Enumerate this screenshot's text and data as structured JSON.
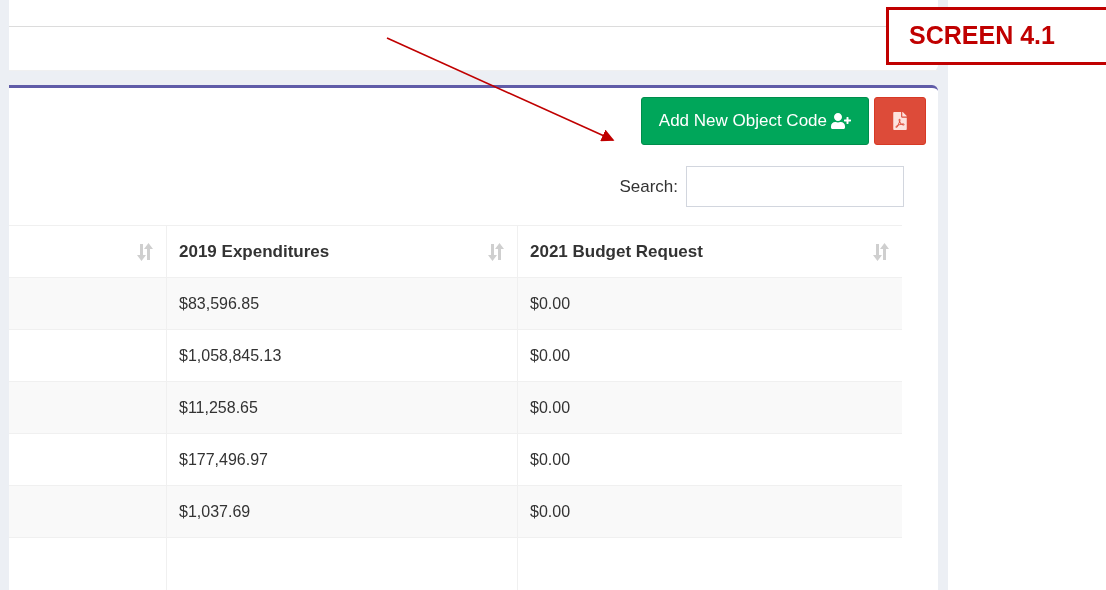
{
  "toolbar": {
    "add_button": {
      "label": "Add New Object Code"
    },
    "pdf_button": {
      "kind": "pdf"
    }
  },
  "search": {
    "label": "Search:"
  },
  "table": {
    "columns": [
      {
        "sortable": true
      },
      {
        "label": "2019 Expenditures",
        "sortable": true
      },
      {
        "label": "2021 Budget Request",
        "sortable": true
      }
    ],
    "rows": [
      {
        "expenditures_2019": "$83,596.85",
        "budget_request_2021": "$0.00"
      },
      {
        "expenditures_2019": "$1,058,845.13",
        "budget_request_2021": "$0.00"
      },
      {
        "expenditures_2019": "$11,258.65",
        "budget_request_2021": "$0.00"
      },
      {
        "expenditures_2019": "$177,496.97",
        "budget_request_2021": "$0.00"
      },
      {
        "expenditures_2019": "$1,037.69",
        "budget_request_2021": "$0.00"
      }
    ]
  },
  "annotation": {
    "label": "SCREEN 4.1"
  }
}
